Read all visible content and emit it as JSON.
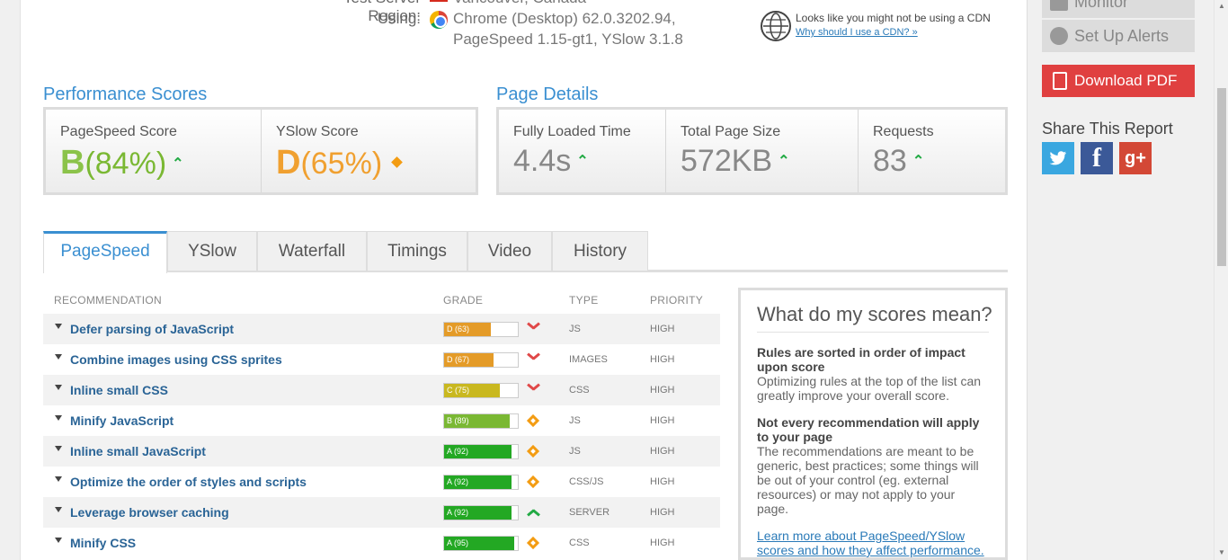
{
  "test_info": {
    "region_label": "Test Server Region:",
    "region_value": "Vancouver, Canada",
    "using_label": "Using:",
    "browser": "Chrome (Desktop) 62.0.3202.94,",
    "versions": "PageSpeed 1.15-gt1, YSlow 3.1.8"
  },
  "cdn": {
    "text": "Looks like you might not be using a CDN",
    "link": "Why should I use a CDN? »"
  },
  "performance": {
    "title": "Performance Scores",
    "pagespeed_label": "PageSpeed Score",
    "pagespeed_grade": "B",
    "pagespeed_pct": "(84%)",
    "yslow_label": "YSlow Score",
    "yslow_grade": "D",
    "yslow_pct": "(65%)"
  },
  "details": {
    "title": "Page Details",
    "load_label": "Fully Loaded Time",
    "load_value": "4.4s",
    "size_label": "Total Page Size",
    "size_value": "572KB",
    "req_label": "Requests",
    "req_value": "83"
  },
  "tabs": [
    "PageSpeed",
    "YSlow",
    "Waterfall",
    "Timings",
    "Video",
    "History"
  ],
  "table": {
    "headers": {
      "recommendation": "RECOMMENDATION",
      "grade": "GRADE",
      "type": "TYPE",
      "priority": "PRIORITY"
    },
    "rows": [
      {
        "name": "Defer parsing of JavaScript",
        "grade": "D (63)",
        "score": 63,
        "color": "#e49b28",
        "trend": "down",
        "type": "JS",
        "priority": "HIGH"
      },
      {
        "name": "Combine images using CSS sprites",
        "grade": "D (67)",
        "score": 67,
        "color": "#e49b28",
        "trend": "down",
        "type": "IMAGES",
        "priority": "HIGH"
      },
      {
        "name": "Inline small CSS",
        "grade": "C (75)",
        "score": 75,
        "color": "#c9b81f",
        "trend": "down",
        "type": "CSS",
        "priority": "HIGH"
      },
      {
        "name": "Minify JavaScript",
        "grade": "B (89)",
        "score": 89,
        "color": "#7ab833",
        "trend": "same",
        "type": "JS",
        "priority": "HIGH"
      },
      {
        "name": "Inline small JavaScript",
        "grade": "A (92)",
        "score": 92,
        "color": "#23a823",
        "trend": "same",
        "type": "JS",
        "priority": "HIGH"
      },
      {
        "name": "Optimize the order of styles and scripts",
        "grade": "A (92)",
        "score": 92,
        "color": "#23a823",
        "trend": "same",
        "type": "CSS/JS",
        "priority": "HIGH"
      },
      {
        "name": "Leverage browser caching",
        "grade": "A (92)",
        "score": 92,
        "color": "#23a823",
        "trend": "up",
        "type": "SERVER",
        "priority": "HIGH"
      },
      {
        "name": "Minify CSS",
        "grade": "A (95)",
        "score": 95,
        "color": "#23a823",
        "trend": "same",
        "type": "CSS",
        "priority": "HIGH"
      }
    ]
  },
  "info_box": {
    "title": "What do my scores mean?",
    "h1": "Rules are sorted in order of impact upon score",
    "p1": "Optimizing rules at the top of the list can greatly improve your overall score.",
    "h2": "Not every recommendation will apply to your page",
    "p2": "The recommendations are meant to be generic, best practices; some things will be out of your control (eg. external resources) or may not apply to your page.",
    "link": "Learn more about PageSpeed/YSlow scores and how they affect performance."
  },
  "sidebar": {
    "monitor": "Monitor",
    "alerts": "Set Up Alerts",
    "pdf": "Download PDF",
    "share": "Share This Report",
    "social": [
      "twitter-icon",
      "facebook-icon",
      "google-plus-icon"
    ]
  }
}
